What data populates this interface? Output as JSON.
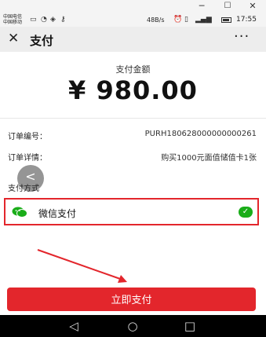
{
  "window": {
    "minimize_glyph": "─",
    "maximize_glyph": "☐",
    "close_glyph": "✕"
  },
  "status_bar": {
    "carrier_1": "中国电信",
    "carrier_2": "中国移动",
    "network_speed": "48B/s",
    "time": "17:55"
  },
  "title_bar": {
    "close_glyph": "✕",
    "title": "支付",
    "more_glyph": "···"
  },
  "amount": {
    "label": "支付金额",
    "value": "¥ 980.00"
  },
  "order": {
    "number_label": "订单编号：",
    "number_value": "PURH180628000000000261",
    "detail_label": "订单详情：",
    "detail_value": "购买1000元面值储值卡1张"
  },
  "payment": {
    "section_label": "支付方式",
    "back_glyph": "<",
    "method_name": "微信支付",
    "selected": true,
    "check_glyph": "✓"
  },
  "pay_button": {
    "label": "立即支付"
  },
  "nav_bar": {
    "back_glyph": "◁",
    "home_glyph": "○",
    "recents_glyph": "□"
  },
  "colors": {
    "accent_red": "#e3262c",
    "wechat_green": "#1aad19",
    "title_bar_bg": "#ededed"
  },
  "icons": [
    "hd-icon",
    "vpn-key-icon",
    "alarm-icon",
    "vibrate-icon",
    "signal-icon",
    "battery-icon",
    "wechat-pay-icon",
    "check-icon",
    "annotation-arrow"
  ]
}
